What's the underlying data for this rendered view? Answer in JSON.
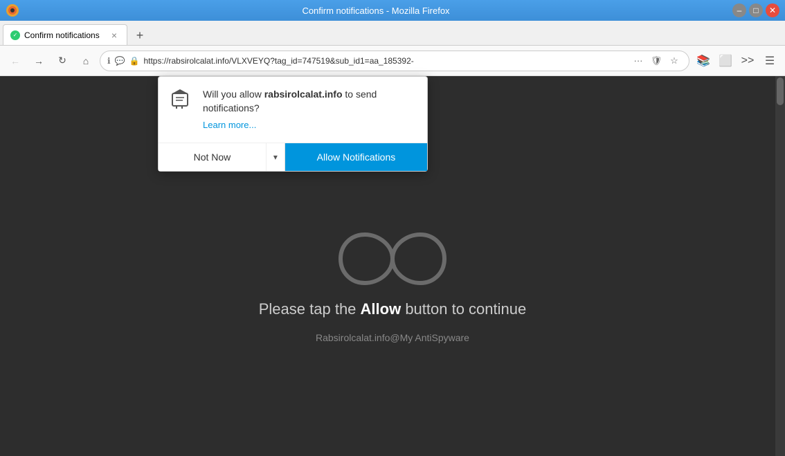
{
  "titlebar": {
    "title": "Confirm notifications - Mozilla Firefox",
    "minimize_label": "–",
    "maximize_label": "□",
    "close_label": "✕"
  },
  "tab": {
    "label": "Confirm notifications",
    "close_label": "×"
  },
  "new_tab": {
    "label": "+"
  },
  "address_bar": {
    "url": "https://rabsirolcalat.info/VLXVEYQ?tag_id=747519&sub_id1=aa_185392-",
    "back_disabled": false,
    "forward_disabled": true
  },
  "notification_popup": {
    "message_prefix": "Will you allow ",
    "domain": "rabsirolcalat.info",
    "message_suffix": " to send notifications?",
    "learn_more": "Learn more...",
    "not_now_label": "Not Now",
    "allow_label": "Allow Notifications"
  },
  "page": {
    "message_prefix": "Please tap the ",
    "message_bold": "Allow",
    "message_suffix": " button to continue",
    "footer": "Rabsirolcalat.info@My AntiSpyware"
  }
}
